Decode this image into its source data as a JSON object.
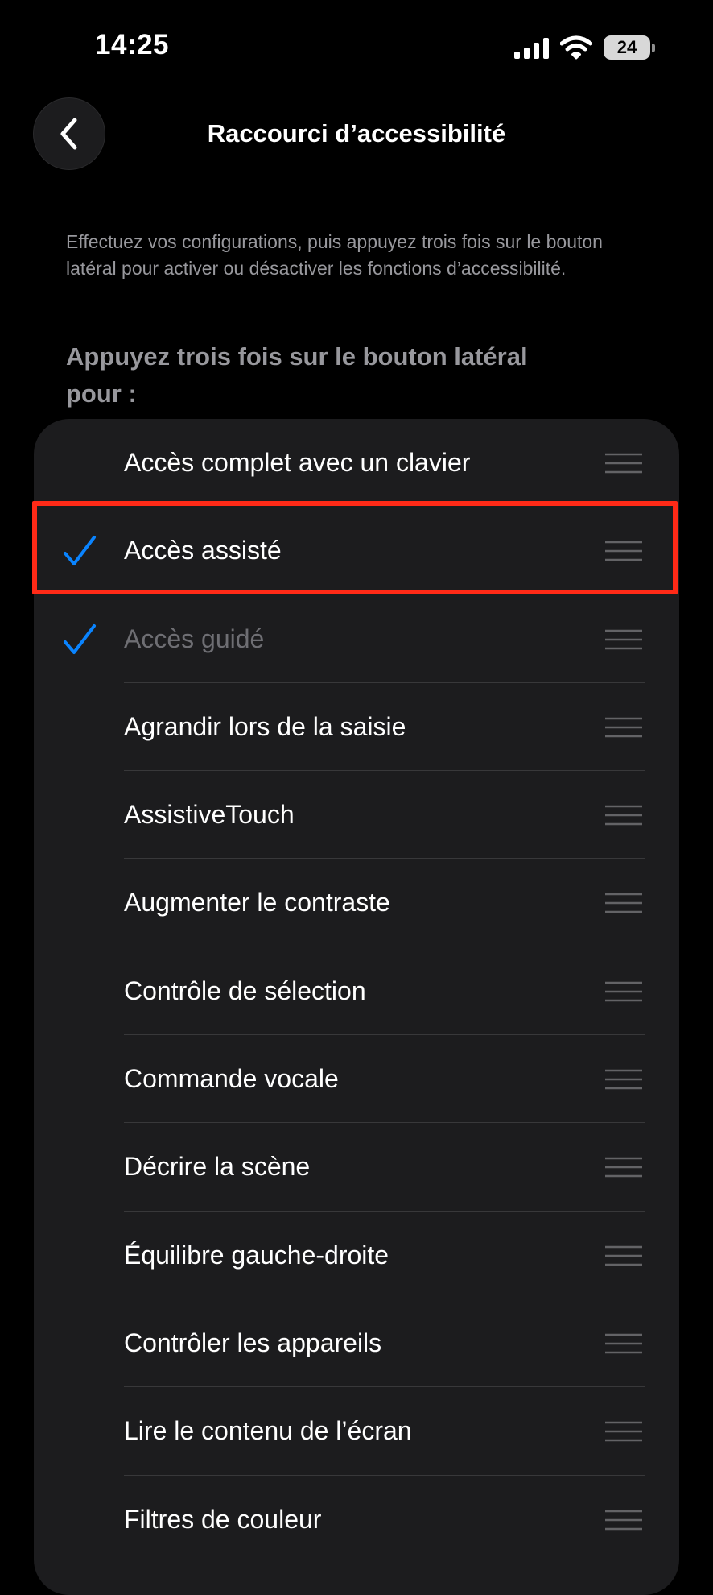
{
  "status_bar": {
    "time": "14:25",
    "battery": "24",
    "icons": [
      "signal-icon",
      "wifi-icon",
      "battery-icon"
    ]
  },
  "nav": {
    "back_icon": "chevron-left-icon",
    "title": "Raccourci d’accessibilité"
  },
  "description": "Effectuez vos configurations, puis appuyez trois fois sur le bouton latéral pour activer ou désactiver les fonctions d’accessibilité.",
  "section_header": "Appuyez trois fois sur le bouton latéral pour :",
  "items": [
    {
      "label": "Accès complet avec un clavier",
      "checked": false
    },
    {
      "label": "Accès assisté",
      "checked": true
    },
    {
      "label": "Accès guidé",
      "checked": true,
      "dimmed": true
    },
    {
      "label": "Agrandir lors de la saisie",
      "checked": false
    },
    {
      "label": "AssistiveTouch",
      "checked": false
    },
    {
      "label": "Augmenter le contraste",
      "checked": false
    },
    {
      "label": "Contrôle de sélection",
      "checked": false
    },
    {
      "label": "Commande vocale",
      "checked": false
    },
    {
      "label": "Décrire la scène",
      "checked": false
    },
    {
      "label": "Équilibre gauche-droite",
      "checked": false
    },
    {
      "label": "Contrôler les appareils",
      "checked": false
    },
    {
      "label": "Lire le contenu de l’écran",
      "checked": false
    },
    {
      "label": "Filtres de couleur",
      "checked": false
    }
  ],
  "colors": {
    "background": "#000000",
    "card": "#1c1c1e",
    "accent": "#0a84ff",
    "highlight": "#ff2a17",
    "secondary_text": "#98989d"
  }
}
